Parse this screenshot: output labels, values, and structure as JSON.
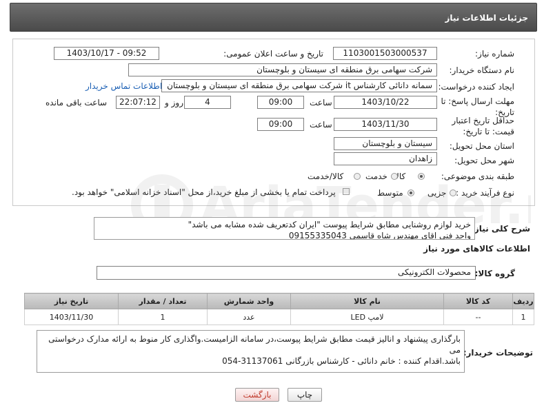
{
  "header": {
    "title": "جزئیات اطلاعات نیاز"
  },
  "fields": {
    "need_number_label": "شماره نیاز:",
    "need_number": "1103001503000537",
    "announce_label": "تاریخ و ساعت اعلان عمومی:",
    "announce_value": "1403/10/17 - 09:52",
    "buyer_org_label": "نام دستگاه خریدار:",
    "buyer_org": "شرکت سهامی برق منطقه ای سیستان و بلوچستان",
    "creator_label": "ایجاد کننده درخواست:",
    "creator": "سمانه دانائی کارشناس it شرکت سهامی برق منطقه ای سیستان و بلوچستان",
    "contact_link": "اطلاعات تماس خریدار",
    "reply_deadline_label": "مهلت ارسال پاسخ: تا تاریخ:",
    "reply_date": "1403/10/22",
    "time_word": "ساعت",
    "reply_time": "09:00",
    "days": "4",
    "day_and": "روز و",
    "remaining_time": "22:07:12",
    "remaining_suffix": "ساعت باقی مانده",
    "price_validity_label": "حداقل تاریخ اعتبار قیمت: تا تاریخ:",
    "validity_date": "1403/11/30",
    "validity_time": "09:00",
    "province_label": "استان محل تحویل:",
    "province": "سیستان و بلوچستان",
    "city_label": "شهر محل تحویل:",
    "city": "زاهدان",
    "category_label": "طبقه بندی موضوعی:",
    "category_options": [
      "کالا",
      "خدمت",
      "کالا/خدمت"
    ],
    "category_selected": "کالا",
    "process_label": "نوع فرآیند خرید :",
    "process_options": [
      "جزیی",
      "متوسط"
    ],
    "process_selected": "متوسط",
    "payment_note": "پرداخت تمام یا بخشی از مبلغ خرید،از محل \"اسناد خزانه اسلامی\" خواهد بود."
  },
  "description": {
    "label": "شرح کلی نیاز:",
    "line1": "خرید لوازم روشنایی مطابق شرایط پیوست \"ایران کدتعریف شده مشابه می باشد\"",
    "line2": "واحد فنی اقای مهندس شاه قاسمی 09155335043"
  },
  "goods_section": {
    "title": "اطلاعات کالاهای مورد نیاز",
    "group_label": "گروه کالا:",
    "group_value": "محصولات الکترونیکی"
  },
  "table": {
    "headers": [
      "ردیف",
      "کد کالا",
      "نام کالا",
      "واحد شمارش",
      "تعداد / مقدار",
      "تاریخ نیاز"
    ],
    "rows": [
      [
        "1",
        "--",
        "لامپ LED",
        "عدد",
        "1",
        "1403/11/30"
      ]
    ]
  },
  "buyer_notes": {
    "label": "توضیحات خریدار:",
    "line1": "بارگذاری پیشنهاد و انالیز قیمت مطابق شرایط پیوست،در سامانه الزامیست.واگذاری کار منوط به ارائه مدارک درخواستی می",
    "line2": "باشد.اقدام کننده : خانم دانائی - کارشناس بازرگانی 31137061-054"
  },
  "buttons": {
    "print": "چاپ",
    "back": "بازگشت"
  },
  "watermark_text": "AriaTender.neT"
}
